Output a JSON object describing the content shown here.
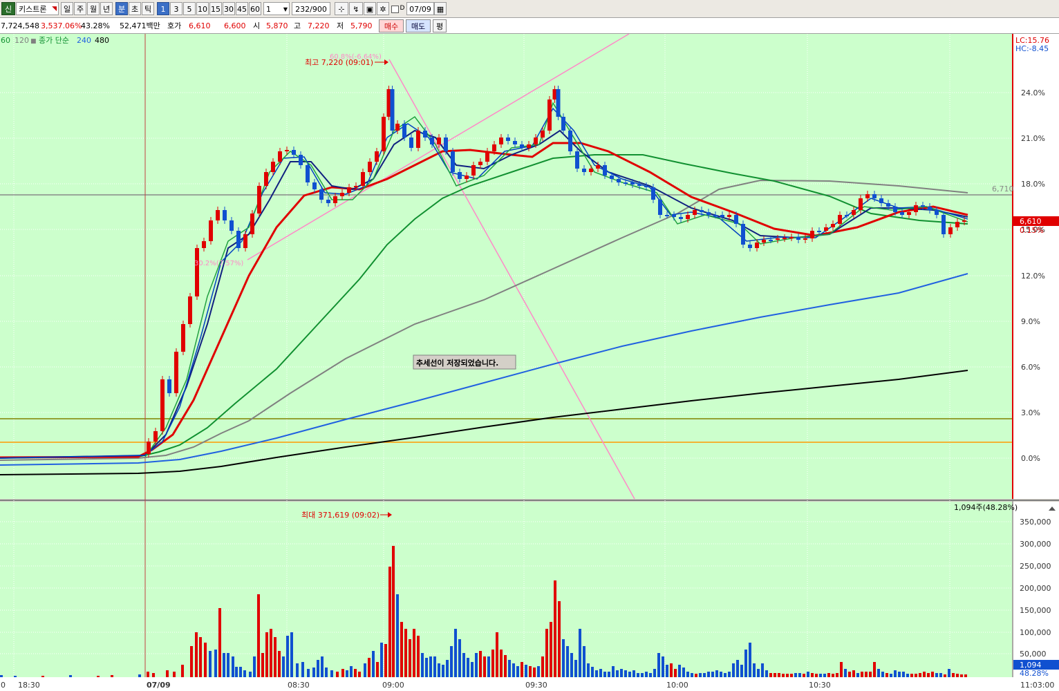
{
  "toolbar": {
    "logo": "신",
    "stock_name": "키스트론",
    "periods": [
      "일",
      "주",
      "월",
      "년",
      "분",
      "초",
      "틱"
    ],
    "minutes": [
      "1",
      "3",
      "5",
      "10",
      "15",
      "30",
      "45",
      "60"
    ],
    "unit_value": "1",
    "count": "232/900",
    "date": "07/09",
    "d_label": "D"
  },
  "info": {
    "volume": "7,724,548",
    "vol_ratio": "3,537.06%",
    "turnover_rate": "43.28%",
    "trade_value": "52,471백만",
    "quote_label": "호가",
    "ask": "6,610",
    "bid": "6,600",
    "open_label": "시",
    "open": "5,870",
    "high_label": "고",
    "high": "7,220",
    "low_label": "저",
    "low": "5,790",
    "buy_label": "매수",
    "sell_label": "매도",
    "eval_label": "평"
  },
  "legend": {
    "ma60": "60",
    "ma120": "120",
    "marker": "■",
    "ma_type": "종가 단순",
    "ma240": "240",
    "ma480": "480"
  },
  "annotations": {
    "high_marker": "최고 7,220 (09:01)",
    "fib_top": "60.8%(-6.64%)",
    "fib_low": "30.2%(7.57%)",
    "trendline_saved": "추세선이 저장되었습니다.",
    "lc": "LC:15.76",
    "hc": "HC:-8.45",
    "hline_label": "6,710",
    "current_price": "6,610",
    "current_pct": "0.15%",
    "max_volume": "최대 371,619 (09:02)",
    "vol_summary": "1,094주(48.28%)",
    "vol_current": "1,094",
    "vol_pct": "48.28%"
  },
  "price_axis": [
    "24.0%",
    "21.0%",
    "18.0%",
    "15.0%",
    "12.0%",
    "9.0%",
    "6.0%",
    "3.0%",
    "0.0%"
  ],
  "volume_axis": [
    "350,000",
    "300,000",
    "250,000",
    "200,000",
    "150,000",
    "100,000",
    "50,000"
  ],
  "time_axis": [
    "0",
    "18:30",
    "07/09",
    "08:30",
    "09:00",
    "09:30",
    "10:00",
    "10:30",
    "11:03:00"
  ],
  "colors": {
    "up": "#e00000",
    "down": "#1050d0",
    "bg": "#ccffcc"
  }
}
